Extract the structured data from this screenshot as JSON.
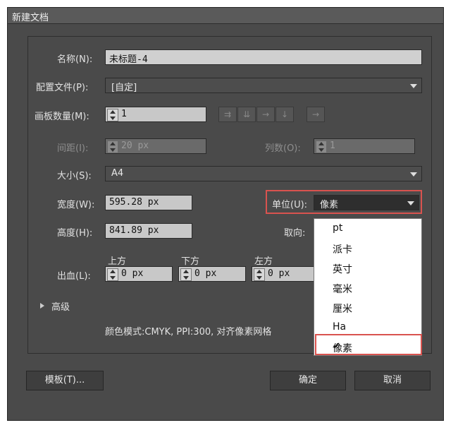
{
  "window": {
    "title": "新建文档"
  },
  "name": {
    "label": "名称(N):",
    "value": "未标题-4"
  },
  "profile": {
    "label": "配置文件(P):",
    "value": "[自定]"
  },
  "artboards": {
    "label": "画板数量(M):",
    "value": "1"
  },
  "spacing": {
    "label": "间距(I):",
    "value": "20 px"
  },
  "columns": {
    "label": "列数(O):",
    "value": "1"
  },
  "size": {
    "label": "大小(S):",
    "value": "A4"
  },
  "width": {
    "label": "宽度(W):",
    "value": "595.28 px"
  },
  "height": {
    "label": "高度(H):",
    "value": "841.89 px"
  },
  "units": {
    "label": "单位(U):",
    "value": "像素",
    "options": [
      "pt",
      "派卡",
      "英寸",
      "毫米",
      "厘米",
      "Ha",
      "像素"
    ]
  },
  "orientation": {
    "label": "取向:"
  },
  "bleed": {
    "label": "出血(L):",
    "top_label": "上方",
    "top_value": "0 px",
    "bottom_label": "下方",
    "bottom_value": "0 px",
    "left_label": "左方",
    "left_value": "0 px"
  },
  "advanced": {
    "label": "高级",
    "info": "颜色模式:CMYK, PPI:300, 对齐像素网格"
  },
  "buttons": {
    "templates": "模板(T)...",
    "ok": "确定",
    "cancel": "取消"
  },
  "colors": {
    "highlight": "#d9534f",
    "dialog": "#4a4a4a"
  }
}
